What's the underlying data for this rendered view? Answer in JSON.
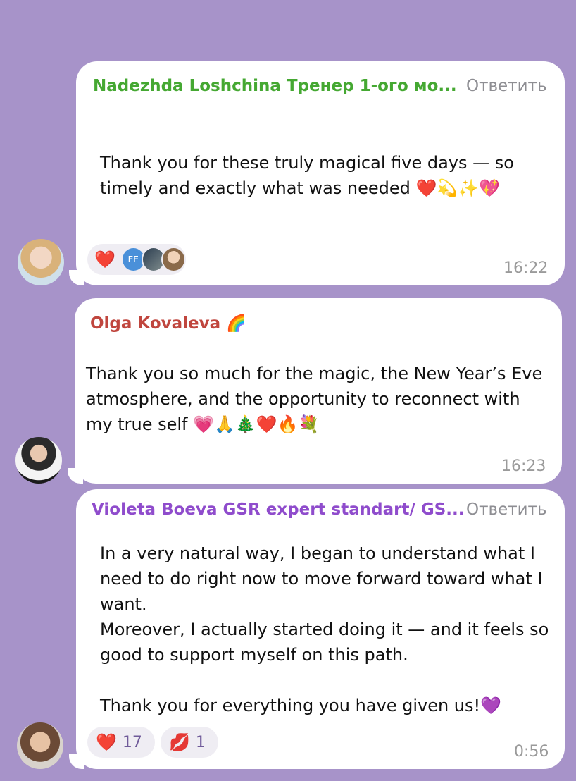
{
  "messages": [
    {
      "sender": "Nadezhda Loshchina Тренер 1-ого мо...",
      "sender_color": "#45a832",
      "reply_label": "Ответить",
      "text": "Thank you for these truly magical five days — so\ntimely and exactly what was needed ❤️💫✨💖",
      "time": "16:22",
      "reactions": [
        {
          "emoji": "❤️"
        },
        {
          "avatar_initials": "EE"
        }
      ]
    },
    {
      "sender": "Olga Kovaleva",
      "sender_emoji": "🌈",
      "sender_color": "#c0463e",
      "text": "Thank you so much for the magic, the New Year’s Eve\natmosphere, and the opportunity to reconnect with\nmy true self 💗🙏🎄❤️🔥💐",
      "time": "16:23"
    },
    {
      "sender": "Violeta Boeva GSR expert standart/ GS...",
      "sender_color": "#8f4ccc",
      "reply_label": "Ответить",
      "text": "In a very natural way, I began to understand what I\nneed to do right now to move forward toward what I\nwant.\nMoreover, I actually started doing it — and it feels so\ngood to support myself on this path.\n\nThank you for everything you have given us!💜",
      "time": "0:56",
      "reactions": [
        {
          "emoji": "❤️",
          "count": "17"
        },
        {
          "emoji": "💋",
          "count": "1"
        }
      ]
    }
  ]
}
